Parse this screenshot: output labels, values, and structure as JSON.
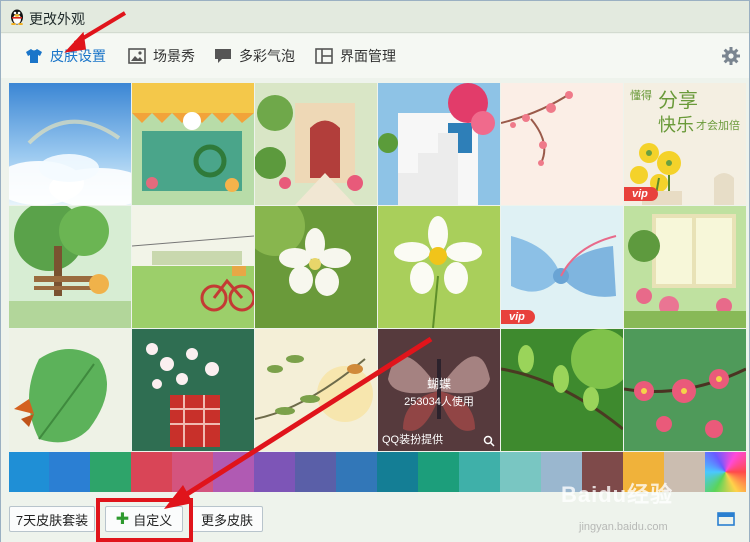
{
  "window": {
    "title": "更改外观"
  },
  "tabs": [
    {
      "label": "皮肤设置",
      "icon": "tshirt-icon",
      "active": true
    },
    {
      "label": "场景秀",
      "icon": "picture-icon",
      "active": false
    },
    {
      "label": "多彩气泡",
      "icon": "speech-bubble-icon",
      "active": false
    },
    {
      "label": "界面管理",
      "icon": "layout-grid-icon",
      "active": false
    }
  ],
  "skins": [
    {
      "name": "sky-clouds",
      "vip": false
    },
    {
      "name": "garden-shop",
      "vip": false
    },
    {
      "name": "flower-alley",
      "vip": false
    },
    {
      "name": "white-stairs-flowers",
      "vip": false
    },
    {
      "name": "plum-blossom",
      "vip": false
    },
    {
      "name": "share-happiness",
      "vip": true,
      "text_line1": "懂得",
      "text_line2": "分享",
      "text_line3": "快乐",
      "text_line4": "才会加倍"
    },
    {
      "name": "bench-tree",
      "vip": false
    },
    {
      "name": "bicycle-field",
      "vip": false
    },
    {
      "name": "white-blossom",
      "vip": false
    },
    {
      "name": "cosmos-flower",
      "vip": false
    },
    {
      "name": "blue-bow",
      "vip": true
    },
    {
      "name": "window-roses",
      "vip": false
    },
    {
      "name": "green-leaf-butterfly",
      "vip": false
    },
    {
      "name": "blossom-pot",
      "vip": false
    },
    {
      "name": "bird-branch",
      "vip": false
    },
    {
      "name": "butterfly",
      "vip": false,
      "hovered": true
    },
    {
      "name": "green-sprout",
      "vip": false
    },
    {
      "name": "pink-flowers",
      "vip": false
    }
  ],
  "vip_label": "vip",
  "hover_card": {
    "name": "蝴蝶",
    "users": "253034人使用",
    "source": "QQ装扮提供"
  },
  "colors": [
    "#1f8fd6",
    "#2b7fd3",
    "#2ea46a",
    "#d94557",
    "#d4547e",
    "#b05ab3",
    "#7d55b7",
    "#5a5fa8",
    "#3277b8",
    "#147e95",
    "#1c9e7b",
    "#3fb0a9",
    "#79c6c2",
    "#9ab7cf",
    "#7e4a4a",
    "#f0b23a",
    "#cbbdb0",
    "rainbow"
  ],
  "buttons": {
    "seven_day": "7天皮肤套装",
    "custom": "自定义",
    "more": "更多皮肤"
  },
  "watermark": {
    "brand": "Baidu经验",
    "url": "jingyan.baidu.com"
  }
}
